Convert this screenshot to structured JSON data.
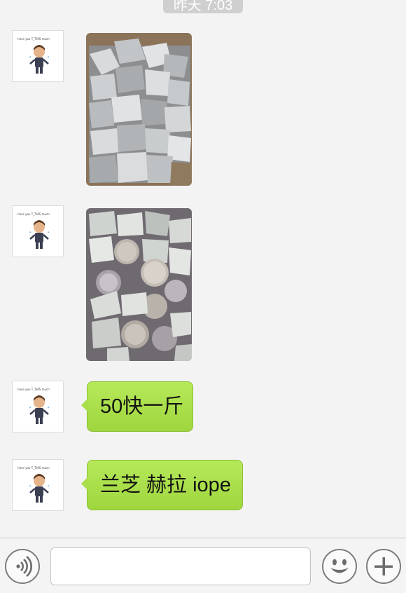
{
  "chat": {
    "timestamp": "昨天 7:03",
    "avatar_caption": "I love you T_THIS much",
    "messages": [
      {
        "type": "image",
        "description": "photo-silver-packets"
      },
      {
        "type": "image",
        "description": "photo-cushion-compacts"
      },
      {
        "type": "text",
        "text": "50快一斤"
      },
      {
        "type": "text",
        "text": "兰芝 赫拉 iope"
      }
    ]
  },
  "input_bar": {
    "voice_icon": "voice-wave-icon",
    "message_placeholder": "",
    "emoji_icon": "smiley-icon",
    "more_icon": "plus-icon"
  },
  "colors": {
    "bubble_green": "#a9dd4a",
    "background": "#f3f3f3",
    "timestamp_bg": "#cfcfcf"
  }
}
